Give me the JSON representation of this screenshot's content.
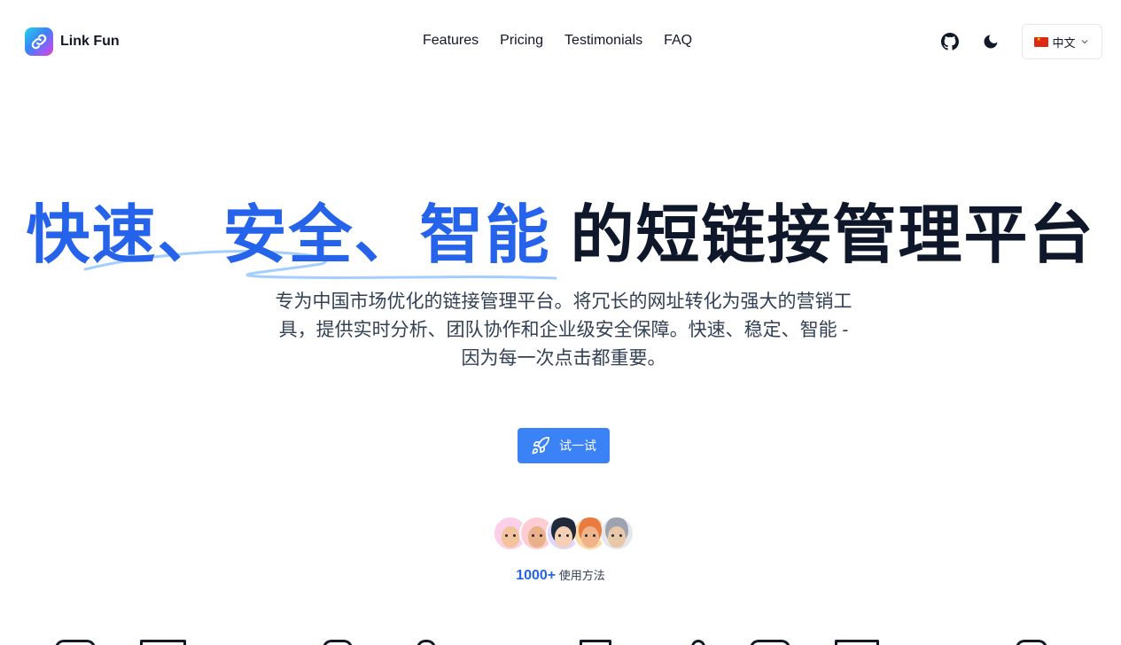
{
  "header": {
    "brand": "Link Fun",
    "nav": [
      "Features",
      "Pricing",
      "Testimonials",
      "FAQ"
    ],
    "language": "中文",
    "icons": [
      "link-logo-icon",
      "github-icon",
      "moon-icon",
      "china-flag-icon",
      "chevron-down-icon"
    ]
  },
  "hero": {
    "title_accent": "快速、安全、智能",
    "title_rest": "的短链接管理平台",
    "subtitle": "专为中国市场优化的链接管理平台。将冗长的网址转化为强大的营销工具，提供实时分析、团队协作和企业级安全保障。快速、稳定、智能 - 因为每一次点击都重要。",
    "cta_label": "试一试",
    "users_count": "1000+",
    "users_label": "使用方法"
  },
  "colors": {
    "accent": "#2563eb",
    "button": "#3b82f6",
    "text": "#0f172a"
  }
}
